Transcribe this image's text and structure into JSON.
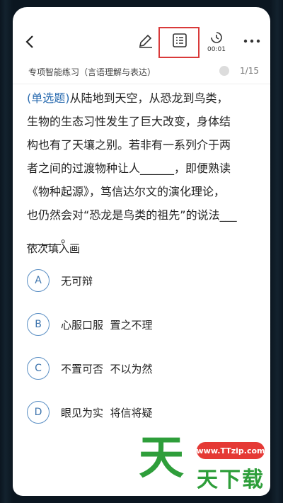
{
  "header": {
    "timer": "00:01"
  },
  "subheader": {
    "title": "专项智能练习（言语理解与表达）",
    "progress": "1/15"
  },
  "question": {
    "tag": "(单选题)",
    "line1": "从陆地到天空，从恐龙到鸟类，",
    "line2": "生物的生态习性发生了巨大改变，身体结",
    "line3": "构也有了天壤之别。若非有一系列介于两",
    "line4": "者之间的过渡物种让人______，即便熟读",
    "line5": "《物种起源》，笃信达尔文的演化理论，",
    "line6": "也仍然会对“恐龙是鸟类的祖先”的说法___",
    "line7": "______。"
  },
  "instruction": "依次填入画",
  "options": [
    {
      "letter": "A",
      "text": "无可辩"
    },
    {
      "letter": "B",
      "text": "心服口服  置之不理"
    },
    {
      "letter": "C",
      "text": "不置可否  不以为然"
    },
    {
      "letter": "D",
      "text": "眼见为实  将信将疑"
    }
  ],
  "watermark": {
    "url": "www.TTzip.com",
    "big_char": "天",
    "small_text": "天下载"
  },
  "colors": {
    "accent": "#2b6cb0",
    "highlight": "#d93a3a",
    "watermark_green": "#2e9e3a"
  }
}
